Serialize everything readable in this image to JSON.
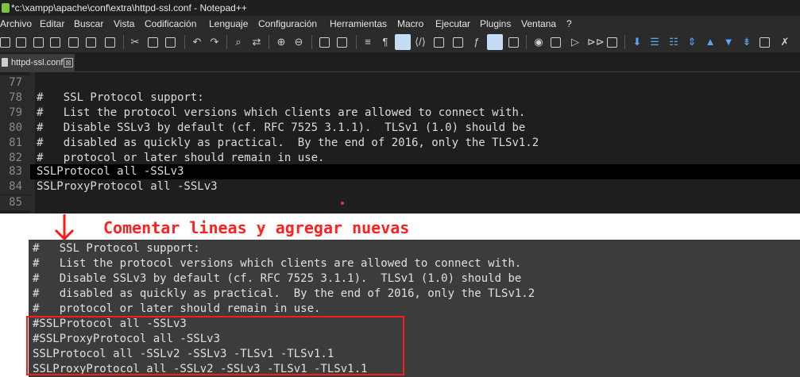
{
  "window": {
    "title": "*c:\\xampp\\apache\\conf\\extra\\httpd-ssl.conf - Notepad++"
  },
  "menu": [
    "Archivo",
    "Editar",
    "Buscar",
    "Vista",
    "Codificación",
    "Lenguaje",
    "Configuración",
    "Herramientas",
    "Macro",
    "Ejecutar",
    "Plugins",
    "Ventana",
    "?"
  ],
  "toolbar_icons": [
    "new-icon",
    "open-icon",
    "save-icon",
    "save-all-icon",
    "close-icon",
    "close-all-icon",
    "print-icon",
    "cut-icon",
    "copy-icon",
    "paste-icon",
    "undo-icon",
    "redo-icon",
    "find-icon",
    "replace-icon",
    "zoom-in-icon",
    "zoom-out-icon",
    "sync-v-icon",
    "sync-h-icon",
    "word-wrap-icon",
    "show-all-icon",
    "indent-guide-icon",
    "udl-icon",
    "doc-map-icon",
    "function-list-icon",
    "folder-workspace-icon",
    "monitor-icon",
    "record-icon",
    "stop-icon",
    "play-icon",
    "run-multiple-icon",
    "save-macro-icon"
  ],
  "tab": {
    "label": "httpd-ssl.conf",
    "close_label": "⊠"
  },
  "editor": {
    "lines": [
      {
        "num": "77",
        "text": ""
      },
      {
        "num": "78",
        "text": "#   SSL Protocol support:"
      },
      {
        "num": "79",
        "text": "#   List the protocol versions which clients are allowed to connect with."
      },
      {
        "num": "80",
        "text": "#   Disable SSLv3 by default (cf. RFC 7525 3.1.1).  TLSv1 (1.0) should be"
      },
      {
        "num": "81",
        "text": "#   disabled as quickly as practical.  By the end of 2016, only the TLSv1.2"
      },
      {
        "num": "82",
        "text": "#   protocol or later should remain in use."
      },
      {
        "num": "83",
        "text": "SSLProtocol all -SSLv3"
      },
      {
        "num": "84",
        "text": "SSLProxyProtocol all -SSLv3"
      },
      {
        "num": "85",
        "text": ""
      }
    ],
    "current_line": "83"
  },
  "annotation": {
    "text": "Comentar lineas y agregar nuevas",
    "color": "#ff2020"
  },
  "result_block": {
    "lines": [
      "#   SSL Protocol support:",
      "#   List the protocol versions which clients are allowed to connect with.",
      "#   Disable SSLv3 by default (cf. RFC 7525 3.1.1).  TLSv1 (1.0) should be",
      "#   disabled as quickly as practical.  By the end of 2016, only the TLSv1.2",
      "#   protocol or later should remain in use.",
      "#SSLProtocol all -SSLv3",
      "#SSLProxyProtocol all -SSLv3",
      "SSLProtocol all -SSLv2 -SSLv3 -TLSv1 -TLSv1.1",
      "SSLProxyProtocol all -SSLv2 -SSLv3 -TLSv1 -TLSv1.1"
    ]
  },
  "colors": {
    "editor_bg": "#1e1e1e",
    "accent_red": "#ff1a1a"
  }
}
